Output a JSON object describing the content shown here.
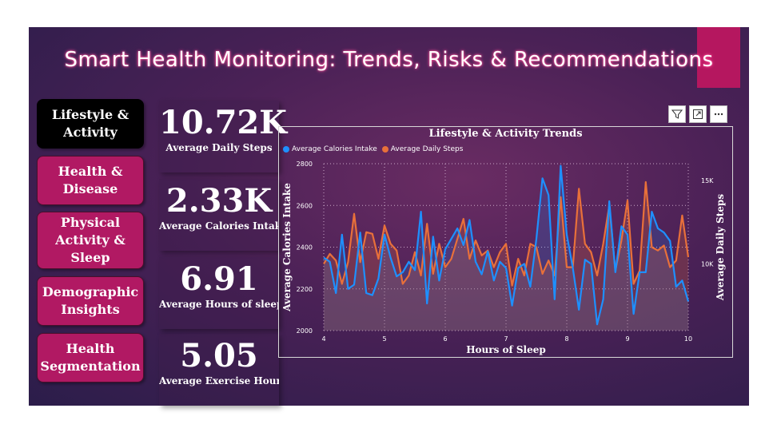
{
  "title": "Smart Health Monitoring: Trends, Risks & Recommendations",
  "nav": [
    {
      "label": "Lifestyle & Activity",
      "active": true
    },
    {
      "label": "Health & Disease",
      "active": false
    },
    {
      "label": "Physical Activity & Sleep",
      "active": false
    },
    {
      "label": "Demographic Insights",
      "active": false
    },
    {
      "label": "Health Segmentation",
      "active": false
    }
  ],
  "kpis": [
    {
      "value": "10.72K",
      "label": "Average Daily Steps"
    },
    {
      "value": "2.33K",
      "label": "Average Calories Intake"
    },
    {
      "value": "6.91",
      "label": "Average Hours of sleep"
    },
    {
      "value": "5.05",
      "label": "Average Exercise Hours ..."
    }
  ],
  "toolbar": {
    "filter_icon": "filter-icon",
    "focus_icon": "focus-mode-icon",
    "more_icon": "more-options-icon"
  },
  "colors": {
    "accent": "#b5175f",
    "calories": "#1e90ff",
    "steps": "#e8703a"
  },
  "chart_data": {
    "type": "line",
    "title": "Lifestyle & Activity Trends",
    "xlabel": "Hours of Sleep",
    "ylabel": "Average Calories Intake",
    "y2label": "Average Daily Steps",
    "xlim": [
      4,
      10
    ],
    "ylim": [
      2000,
      2800
    ],
    "y2lim": [
      6000,
      16000
    ],
    "xticks": [
      "4",
      "5",
      "6",
      "7",
      "8",
      "9",
      "10"
    ],
    "yticks": [
      "2000",
      "2200",
      "2400",
      "2600",
      "2800"
    ],
    "y2ticks": [
      "10K",
      "15K"
    ],
    "grid": true,
    "legend": "top-left",
    "series": [
      {
        "name": "Average Calories Intake",
        "axis": "left",
        "x": [
          4.0,
          4.1,
          4.2,
          4.3,
          4.4,
          4.5,
          4.6,
          4.7,
          4.8,
          4.9,
          5.0,
          5.1,
          5.2,
          5.3,
          5.4,
          5.5,
          5.6,
          5.7,
          5.8,
          5.9,
          6.0,
          6.1,
          6.2,
          6.3,
          6.4,
          6.5,
          6.6,
          6.7,
          6.8,
          6.9,
          7.0,
          7.1,
          7.2,
          7.3,
          7.4,
          7.5,
          7.6,
          7.7,
          7.8,
          7.9,
          8.0,
          8.1,
          8.2,
          8.3,
          8.4,
          8.5,
          8.6,
          8.7,
          8.8,
          8.9,
          9.0,
          9.1,
          9.2,
          9.3,
          9.4,
          9.5,
          9.6,
          9.7,
          9.8,
          9.9,
          10.0
        ],
        "values": [
          2350,
          2330,
          2180,
          2460,
          2200,
          2220,
          2470,
          2180,
          2170,
          2250,
          2460,
          2350,
          2260,
          2280,
          2330,
          2290,
          2570,
          2130,
          2450,
          2240,
          2390,
          2440,
          2490,
          2410,
          2530,
          2330,
          2270,
          2380,
          2240,
          2330,
          2300,
          2120,
          2300,
          2320,
          2210,
          2440,
          2730,
          2650,
          2150,
          2790,
          2460,
          2300,
          2100,
          2340,
          2320,
          2030,
          2150,
          2620,
          2280,
          2500,
          2460,
          2080,
          2280,
          2280,
          2570,
          2490,
          2470,
          2430,
          2210,
          2240,
          2140
        ]
      },
      {
        "name": "Average Daily Steps",
        "axis": "right",
        "x": [
          4.0,
          4.1,
          4.2,
          4.3,
          4.4,
          4.5,
          4.6,
          4.7,
          4.8,
          4.9,
          5.0,
          5.1,
          5.2,
          5.3,
          5.4,
          5.5,
          5.6,
          5.7,
          5.8,
          5.9,
          6.0,
          6.1,
          6.2,
          6.3,
          6.4,
          6.5,
          6.6,
          6.7,
          6.8,
          6.9,
          7.0,
          7.1,
          7.2,
          7.3,
          7.4,
          7.5,
          7.6,
          7.7,
          7.8,
          7.9,
          8.0,
          8.1,
          8.2,
          8.3,
          8.4,
          8.5,
          8.6,
          8.7,
          8.8,
          8.9,
          9.0,
          9.1,
          9.2,
          9.3,
          9.4,
          9.5,
          9.6,
          9.7,
          9.8,
          9.9,
          10.0
        ],
        "values": [
          10000,
          10600,
          10200,
          8800,
          10100,
          13000,
          10100,
          11900,
          11800,
          10300,
          12300,
          11200,
          10800,
          8800,
          9300,
          10700,
          9300,
          12400,
          9400,
          11200,
          9800,
          10300,
          11500,
          12700,
          10300,
          11400,
          10500,
          10800,
          9800,
          10700,
          11200,
          8700,
          10300,
          9300,
          11200,
          11000,
          9400,
          10200,
          9300,
          14000,
          9800,
          9800,
          14500,
          11200,
          10700,
          9300,
          11200,
          13500,
          9600,
          11400,
          13800,
          8800,
          9600,
          14900,
          11000,
          10800,
          11100,
          9800,
          10200,
          12900,
          10400
        ]
      }
    ]
  }
}
